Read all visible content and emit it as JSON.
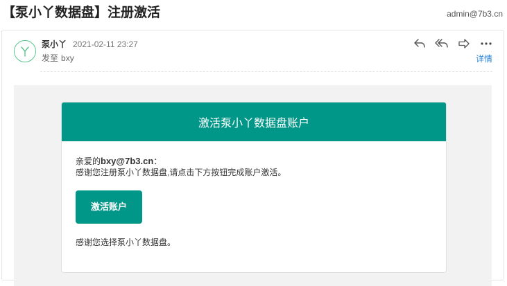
{
  "subject": {
    "title": "【泵小丫数据盘】注册激活",
    "account_email": "admin@7b3.cn"
  },
  "message": {
    "sender_name": "泵小丫",
    "send_time": "2021-02-11 23:27",
    "to_prefix": "发至",
    "to_name": "bxy",
    "details_label": "详情",
    "actions": [
      "reply-icon",
      "reply-all-icon",
      "forward-icon",
      "more-icon"
    ]
  },
  "email": {
    "header_title": "激活泵小丫数据盘账户",
    "greeting_prefix": "亲爱的",
    "greeting_email": "bxy@7b3.cn",
    "greeting_suffix": "：",
    "intro": "感谢您注册泵小丫数据盘,请点击下方按钮完成账户激活。",
    "button_label": "激活账户",
    "thanks": "感谢您选择泵小丫数据盘。"
  },
  "colors": {
    "accent": "#009688",
    "link": "#2f86d6",
    "avatar_ring": "#5bc58b"
  }
}
